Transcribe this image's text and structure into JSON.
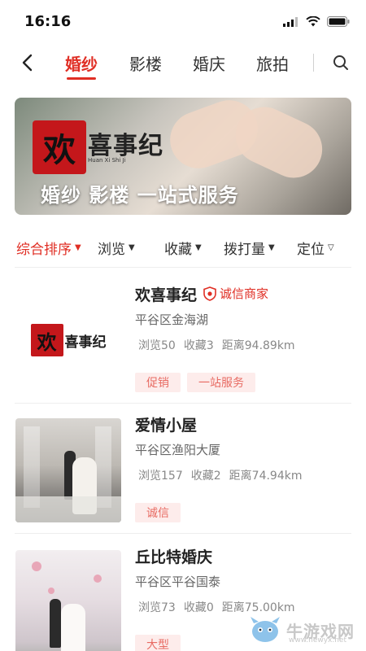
{
  "status_bar": {
    "time": "16:16"
  },
  "nav": {
    "tabs": [
      {
        "label": "婚纱",
        "active": true
      },
      {
        "label": "影楼",
        "active": false
      },
      {
        "label": "婚庆",
        "active": false
      },
      {
        "label": "旅拍",
        "active": false
      }
    ]
  },
  "banner": {
    "logo_main": "欢",
    "logo_rest": "喜事纪",
    "logo_sub": "Huan Xi Shi Ji",
    "slogan": "婚纱 影楼 一站式服务"
  },
  "filters": [
    {
      "label": "综合排序",
      "caret": "▼",
      "active": true
    },
    {
      "label": "浏览",
      "caret": "▼",
      "active": false
    },
    {
      "label": "收藏",
      "caret": "▼",
      "active": false
    },
    {
      "label": "拨打量",
      "caret": "▼",
      "active": false
    },
    {
      "label": "定位",
      "caret": "▽",
      "active": false
    }
  ],
  "shops": [
    {
      "name": "欢喜事纪",
      "badge": "诚信商家",
      "address": "平谷区金海湖",
      "views": "浏览50",
      "favorites": "收藏3",
      "distance": "距离94.89km",
      "tags": [
        "促销",
        "一站服务"
      ],
      "thumb": "logo"
    },
    {
      "name": "爱情小屋",
      "address": "平谷区渔阳大厦",
      "views": "浏览157",
      "favorites": "收藏2",
      "distance": "距离74.94km",
      "tags": [
        "诚信"
      ],
      "thumb": "photo1"
    },
    {
      "name": "丘比特婚庆",
      "address": "平谷区平谷国泰",
      "views": "浏览73",
      "favorites": "收藏0",
      "distance": "距离75.00km",
      "tags": [
        "大型"
      ],
      "thumb": "photo2"
    }
  ],
  "watermark": {
    "text": "牛游戏网",
    "url": "www.newyx.net"
  },
  "colors": {
    "accent": "#e02e24",
    "tag_bg": "#fdeceb",
    "tag_text": "#e86b63"
  },
  "icons": [
    "back-arrow-icon",
    "search-icon",
    "shield-icon",
    "signal-icon",
    "wifi-icon",
    "battery-icon"
  ]
}
